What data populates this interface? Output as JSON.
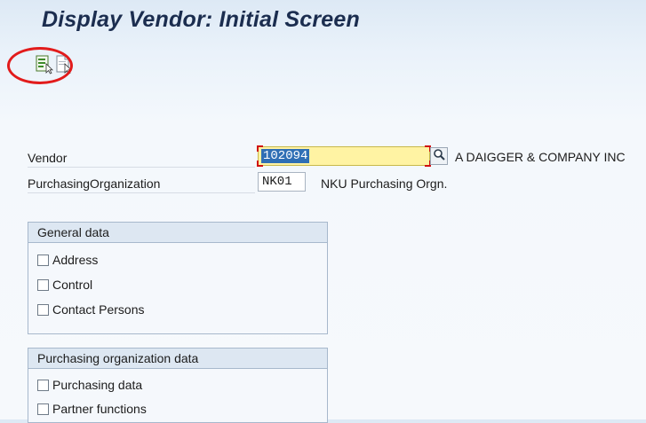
{
  "window": {
    "title": "Display Vendor:  Initial Screen"
  },
  "toolbar": {
    "buttons": [
      {
        "icon": "execute-icon"
      },
      {
        "icon": "display-document-icon"
      }
    ]
  },
  "fields": {
    "vendor": {
      "label": "Vendor",
      "value": "102094",
      "description": "A DAIGGER & COMPANY INC"
    },
    "purch_org": {
      "label": "PurchasingOrganization",
      "value": "NK01",
      "description": "NKU Purchasing Orgn."
    }
  },
  "general_data": {
    "title": "General data",
    "options": [
      {
        "label": "Address",
        "checked": false
      },
      {
        "label": "Control",
        "checked": false
      },
      {
        "label": "Contact Persons",
        "checked": false
      }
    ]
  },
  "purchasing_org_data": {
    "title": "Purchasing organization data",
    "options": [
      {
        "label": "Purchasing data",
        "checked": false
      },
      {
        "label": "Partner functions",
        "checked": false
      }
    ]
  },
  "colors": {
    "title_text": "#1b2d4f",
    "required_field": "#fff3a3",
    "selection": "#2f6fb5",
    "annotation_circle": "#e21b1b"
  }
}
